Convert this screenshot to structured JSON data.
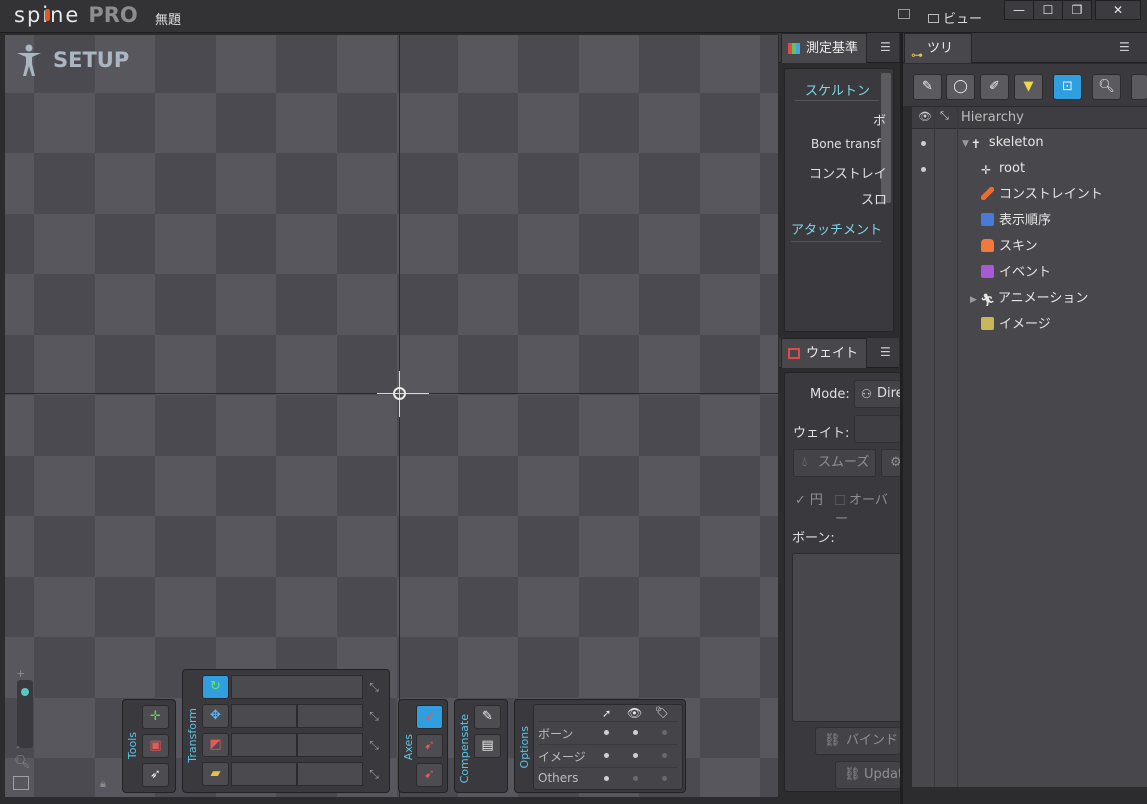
{
  "app": {
    "logo_text": "spine",
    "logo_edition": "PRO",
    "document_title": "無題",
    "view_menu": "ビュー"
  },
  "viewport": {
    "mode_label": "SETUP",
    "tool_groups": {
      "tools_label": "Tools",
      "transform_label": "Transform",
      "axes_label": "Axes",
      "compensate_label": "Compensate",
      "options_label": "Options"
    },
    "options_rows": [
      "ボーン",
      "イメージ",
      "Others"
    ]
  },
  "metrics_panel": {
    "tab_label": "測定基準",
    "sections": [
      {
        "label": "スケルトン",
        "accent": true
      },
      {
        "label": "ボ",
        "accent": false
      },
      {
        "label": "Bone transf",
        "accent": false
      },
      {
        "label": "コンストレイ",
        "accent": false
      },
      {
        "label": "スロ",
        "accent": false
      },
      {
        "label": "アタッチメント",
        "accent": true
      }
    ]
  },
  "weights_panel": {
    "tab_label": "ウェイト",
    "mode_label": "Mode:",
    "mode_value": "Dire",
    "weight_label": "ウェイト:",
    "smooth_button": "スムーズ",
    "circle_checkbox": "円",
    "overlay_checkbox": "オーバー",
    "bones_label": "ボーン:",
    "bind_button": "バインド",
    "update_button": "Updat"
  },
  "tree_panel": {
    "tab_label": "ツリー",
    "column_header": "Hierarchy",
    "items": [
      {
        "label": "skeleton",
        "level": 0
      },
      {
        "label": "root",
        "level": 1
      },
      {
        "label": "コンストレイント",
        "level": 1
      },
      {
        "label": "表示順序",
        "level": 1
      },
      {
        "label": "スキン",
        "level": 1
      },
      {
        "label": "イベント",
        "level": 1
      },
      {
        "label": "アニメーション",
        "level": 1
      },
      {
        "label": "イメージ",
        "level": 1
      }
    ]
  },
  "colors": {
    "accent_blue": "#2f9fe0",
    "accent_cyan": "#5cc6e6",
    "logo_orange": "#e05a27"
  }
}
